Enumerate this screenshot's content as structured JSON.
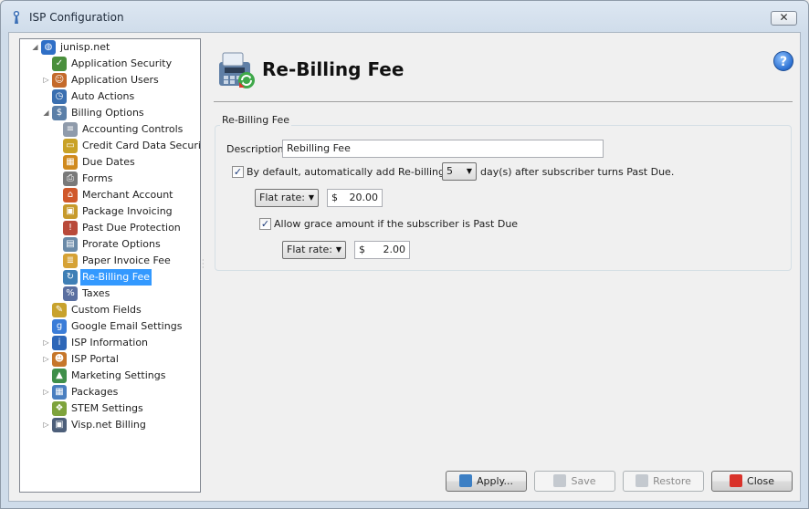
{
  "window": {
    "title": "ISP Configuration",
    "close_glyph": "✕"
  },
  "tree": {
    "items": [
      {
        "label": "junisp.net",
        "level": 0,
        "expander": "open",
        "icon": "globe-icon",
        "color": "#2f6fc6",
        "glyph": "◍"
      },
      {
        "label": "Application Security",
        "level": 1,
        "expander": "",
        "icon": "shield-lock-icon",
        "color": "#4a8f3c",
        "glyph": "✓"
      },
      {
        "label": "Application Users",
        "level": 1,
        "expander": "closed",
        "icon": "users-icon",
        "color": "#c46a2b",
        "glyph": "☺"
      },
      {
        "label": "Auto Actions",
        "level": 1,
        "expander": "",
        "icon": "clock-icon",
        "color": "#3a6fb0",
        "glyph": "◷"
      },
      {
        "label": "Billing Options",
        "level": 1,
        "expander": "open",
        "icon": "billing-icon",
        "color": "#5b7fa8",
        "glyph": "$"
      },
      {
        "label": "Accounting Controls",
        "level": 2,
        "expander": "",
        "icon": "ledger-icon",
        "color": "#8f9bab",
        "glyph": "≡"
      },
      {
        "label": "Credit Card Data Security",
        "level": 2,
        "expander": "",
        "icon": "credit-card-lock-icon",
        "color": "#c9a227",
        "glyph": "▭"
      },
      {
        "label": "Due Dates",
        "level": 2,
        "expander": "",
        "icon": "calendar-icon",
        "color": "#d08a1e",
        "glyph": "▦"
      },
      {
        "label": "Forms",
        "level": 2,
        "expander": "",
        "icon": "printer-icon",
        "color": "#7a7a7a",
        "glyph": "⎙"
      },
      {
        "label": "Merchant Account",
        "level": 2,
        "expander": "",
        "icon": "merchant-icon",
        "color": "#d0582a",
        "glyph": "⌂"
      },
      {
        "label": "Package Invoicing",
        "level": 2,
        "expander": "",
        "icon": "package-invoice-icon",
        "color": "#c79a2b",
        "glyph": "▣"
      },
      {
        "label": "Past Due Protection",
        "level": 2,
        "expander": "",
        "icon": "past-due-icon",
        "color": "#b94a3a",
        "glyph": "!"
      },
      {
        "label": "Prorate Options",
        "level": 2,
        "expander": "",
        "icon": "calculator-icon",
        "color": "#6a8aa8",
        "glyph": "▤"
      },
      {
        "label": "Paper Invoice Fee",
        "level": 2,
        "expander": "",
        "icon": "paper-invoice-icon",
        "color": "#d6a235",
        "glyph": "≣"
      },
      {
        "label": "Re-Billing Fee",
        "level": 2,
        "expander": "",
        "icon": "rebilling-icon",
        "color": "#3f7fb5",
        "glyph": "↻",
        "selected": true
      },
      {
        "label": "Taxes",
        "level": 2,
        "expander": "",
        "icon": "percent-icon",
        "color": "#5a6fa0",
        "glyph": "%"
      },
      {
        "label": "Custom Fields",
        "level": 1,
        "expander": "",
        "icon": "pencil-icon",
        "color": "#c8a22d",
        "glyph": "✎"
      },
      {
        "label": "Google Email Settings",
        "level": 1,
        "expander": "",
        "icon": "google-icon",
        "color": "#3b7dd8",
        "glyph": "g"
      },
      {
        "label": "ISP Information",
        "level": 1,
        "expander": "closed",
        "icon": "info-icon",
        "color": "#2e67b8",
        "glyph": "i"
      },
      {
        "label": "ISP Portal",
        "level": 1,
        "expander": "closed",
        "icon": "portal-icon",
        "color": "#c6762a",
        "glyph": "☻"
      },
      {
        "label": "Marketing Settings",
        "level": 1,
        "expander": "",
        "icon": "chart-icon",
        "color": "#3f8f4a",
        "glyph": "▲"
      },
      {
        "label": "Packages",
        "level": 1,
        "expander": "closed",
        "icon": "packages-icon",
        "color": "#4a7fc0",
        "glyph": "▦"
      },
      {
        "label": "STEM Settings",
        "level": 1,
        "expander": "",
        "icon": "stem-icon",
        "color": "#7ea33c",
        "glyph": "❖"
      },
      {
        "label": "Visp.net Billing",
        "level": 1,
        "expander": "closed",
        "icon": "visp-billing-icon",
        "color": "#4d5f7a",
        "glyph": "▣"
      }
    ]
  },
  "page": {
    "title": "Re-Billing Fee",
    "help_glyph": "?"
  },
  "group": {
    "legend": "Re-Billing Fee",
    "description_label": "Description:",
    "description_value": "Rebilling Fee",
    "auto_add_checked": true,
    "auto_add_label": "By default, automatically add Re-billing Fee",
    "days_value": "5",
    "days_suffix": "day(s) after subscriber turns Past Due.",
    "rate_type": "Flat rate:",
    "currency": "$",
    "rate_value": "20.00",
    "grace_checked": true,
    "grace_label": "Allow grace amount if the subscriber is Past Due",
    "grace_rate_type": "Flat rate:",
    "grace_currency": "$",
    "grace_value": "2.00",
    "check_glyph": "✓",
    "dropdown_glyph": "▼"
  },
  "buttons": {
    "apply": "Apply...",
    "save": "Save",
    "restore": "Restore",
    "close": "Close"
  }
}
